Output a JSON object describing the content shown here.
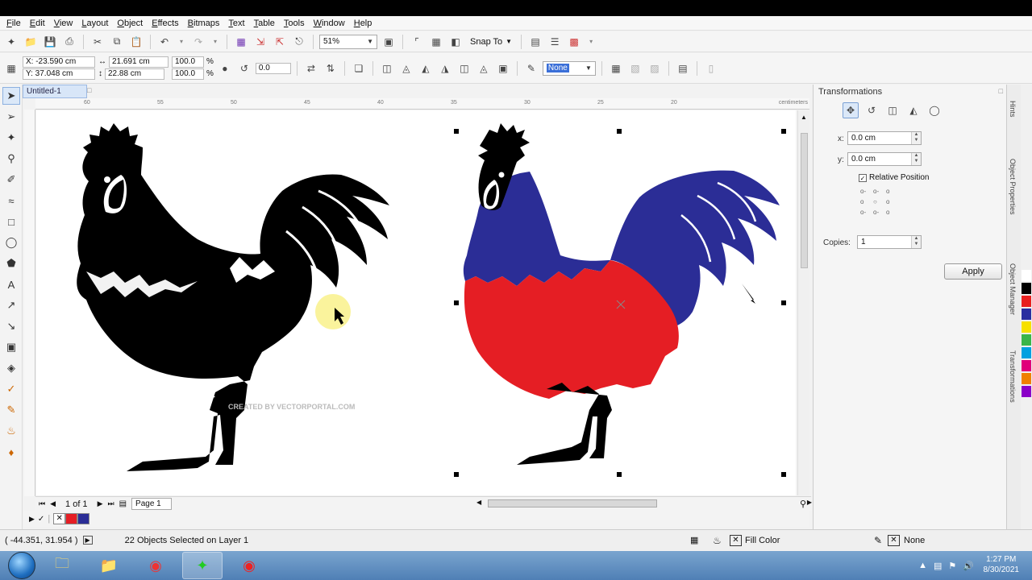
{
  "menu": [
    "File",
    "Edit",
    "View",
    "Layout",
    "Object",
    "Effects",
    "Bitmaps",
    "Text",
    "Table",
    "Tools",
    "Window",
    "Help"
  ],
  "toolbar": {
    "zoom": "51%",
    "snap_to": "Snap To"
  },
  "property_bar": {
    "x": "X: -23.590 cm",
    "y": "Y: 37.048 cm",
    "width": "21.691 cm",
    "height": "22.88 cm",
    "scale_x": "100.0",
    "scale_y": "100.0",
    "percent": "%",
    "rotation": "0.0",
    "outline": "None"
  },
  "document": {
    "tab": "Untitled-1",
    "ruler_labels": [
      "60",
      "55",
      "50",
      "45",
      "40",
      "35",
      "30",
      "25",
      "20"
    ],
    "ruler_unit": "centimeters",
    "watermark": "CREATED BY VECTORPORTAL.COM"
  },
  "pager": {
    "page_count": "1 of 1",
    "page_tab": "Page 1"
  },
  "status": {
    "cursor": "( -44.351, 31.954 )",
    "selection": "22 Objects Selected on Layer 1",
    "fill": "Fill Color",
    "outline": "None"
  },
  "docker": {
    "title": "Transformations",
    "x_label": "x:",
    "x_value": "0.0 cm",
    "y_label": "y:",
    "y_value": "0.0 cm",
    "relative_position": "Relative Position",
    "copies_label": "Copies:",
    "copies_value": "1",
    "apply": "Apply"
  },
  "docker_tabs": [
    "Hints",
    "Object Properties",
    "Object Manager",
    "Transformations"
  ],
  "palette_colors": [
    "#ffffff",
    "#000000",
    "#e82020",
    "#2a2fa0",
    "#f7e000",
    "#3bb54a",
    "#00a0e0",
    "#e0007a",
    "#f08000",
    "#8b00c8"
  ],
  "fill_colors": {
    "red": "#e51e24",
    "blue": "#2b2d96",
    "black": "#000000"
  },
  "taskbar": {
    "time": "1:27 PM",
    "date": "8/30/2021"
  }
}
